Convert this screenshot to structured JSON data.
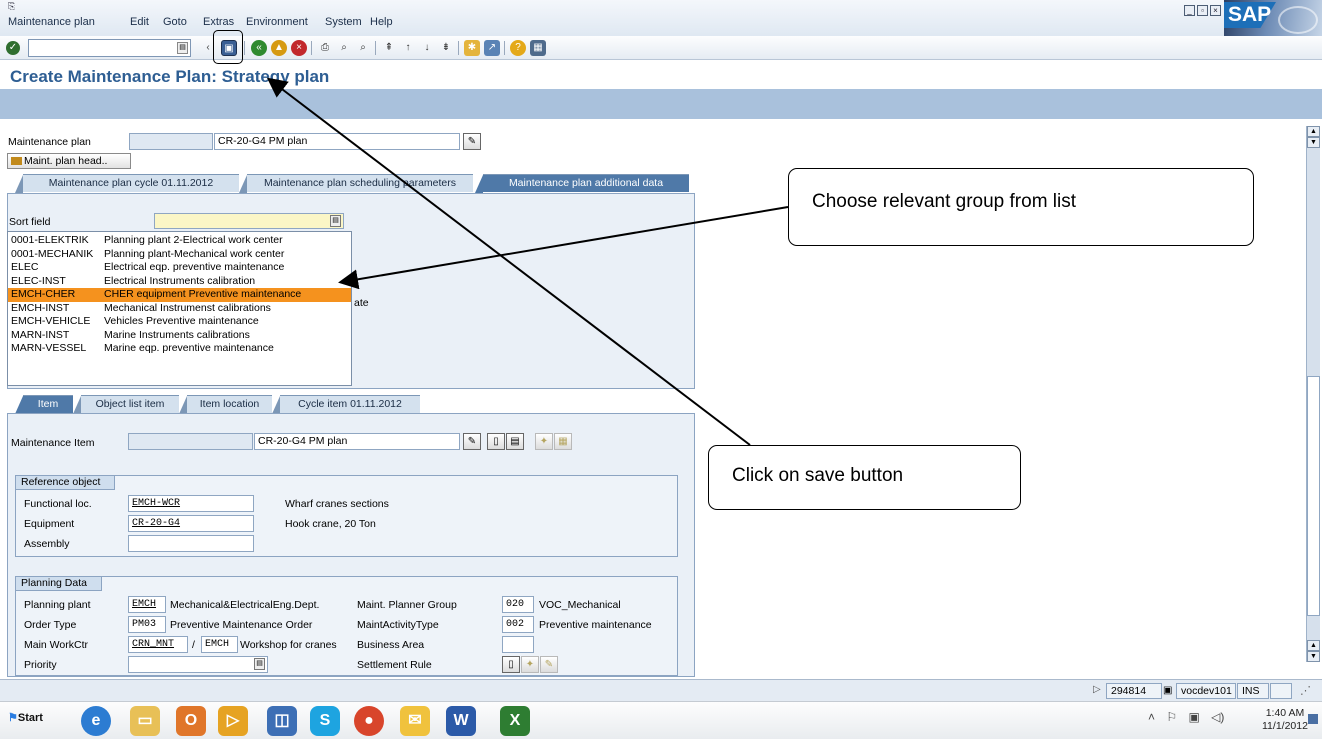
{
  "menubar": {
    "items": [
      "Maintenance plan",
      "Edit",
      "Goto",
      "Extras",
      "Environment",
      "System",
      "Help"
    ],
    "sap_logo": "SAP"
  },
  "toolbar": {
    "icons": [
      "enter-icon",
      "command-field-dropdown-icon",
      "back-arrow-icon",
      "save-icon",
      "back-icon",
      "exit-icon",
      "cancel-icon",
      "print-icon",
      "find-icon",
      "find-next-icon",
      "first-page-icon",
      "previous-page-icon",
      "next-page-icon",
      "last-page-icon",
      "create-session-icon",
      "shortcut-icon",
      "help-icon",
      "customize-layout-icon"
    ]
  },
  "title": "Create Maintenance Plan: Strategy plan",
  "header": {
    "plan_label": "Maintenance plan",
    "plan_text": "CR-20-G4 PM plan",
    "head_button": "Maint. plan head.."
  },
  "top_tabs": [
    "Maintenance plan cycle 01.11.2012",
    "Maintenance plan scheduling parameters",
    "Maintenance plan additional data"
  ],
  "sort_field_label": "Sort field",
  "dropdown": {
    "rows": [
      {
        "key": "0001-ELEKTRIK",
        "desc": "Planning plant 2-Electrical work center"
      },
      {
        "key": "0001-MECHANIK",
        "desc": "Planning plant-Mechanical work center"
      },
      {
        "key": "ELEC",
        "desc": "Electrical  eqp. preventive maintenance"
      },
      {
        "key": "ELEC-INST",
        "desc": "Electrical Instruments calibration"
      },
      {
        "key": "EMCH-CHER",
        "desc": "CHER equipment Preventive maintenance"
      },
      {
        "key": "EMCH-INST",
        "desc": "Mechanical Instrumenst calibrations"
      },
      {
        "key": "EMCH-VEHICLE",
        "desc": "Vehicles Preventive maintenance"
      },
      {
        "key": "MARN-INST",
        "desc": "Marine Instruments calibrations"
      },
      {
        "key": "MARN-VESSEL",
        "desc": "Marine eqp. preventive maintenance"
      }
    ],
    "selected_index": 4,
    "partially_hidden_text": "ate"
  },
  "item_tabs": [
    "Item",
    "Object list item",
    "Item location",
    "Cycle item 01.11.2012"
  ],
  "item": {
    "label": "Maintenance Item",
    "text": "CR-20-G4 PM plan"
  },
  "reference_object": {
    "title": "Reference object",
    "functional_loc_label": "Functional loc.",
    "functional_loc": "EMCH-WCR",
    "functional_loc_desc": "Wharf cranes sections",
    "equipment_label": "Equipment",
    "equipment": "CR-20-G4",
    "equipment_desc": "Hook crane, 20 Ton",
    "assembly_label": "Assembly",
    "assembly": ""
  },
  "planning_data": {
    "title": "Planning Data",
    "planning_plant_label": "Planning plant",
    "planning_plant": "EMCH",
    "planning_plant_desc": "Mechanical&ElectricalEng.Dept.",
    "planner_group_label": "Maint. Planner Group",
    "planner_group": "020",
    "planner_group_desc": "VOC_Mechanical",
    "order_type_label": "Order Type",
    "order_type": "PM03",
    "order_type_desc": "Preventive Maintenance Order",
    "activity_type_label": "MaintActivityType",
    "activity_type": "002",
    "activity_type_desc": "Preventive maintenance",
    "work_ctr_label": "Main WorkCtr",
    "work_ctr": "CRN_MNT",
    "work_ctr_sep": "/",
    "work_ctr_plant": "EMCH",
    "work_ctr_desc": "Workshop for cranes",
    "business_area_label": "Business Area",
    "business_area": "",
    "priority_label": "Priority",
    "priority": "",
    "settlement_rule_label": "Settlement Rule"
  },
  "statusbar": {
    "session": "294814",
    "server": "vocdev101",
    "mode": "INS"
  },
  "taskbar": {
    "start": "Start",
    "time": "1:40 AM",
    "date": "11/1/2012",
    "apps": [
      "internet-explorer-icon",
      "file-explorer-icon",
      "outlook-icon",
      "sap-logon-icon",
      "remote-desktop-icon",
      "skype-icon",
      "chrome-icon",
      "lotus-notes-icon",
      "word-icon",
      "excel-icon"
    ]
  },
  "callouts": {
    "group": "Choose relevant group from list",
    "save": "Click on save button"
  },
  "colors": {
    "title": "#2e5e93",
    "tab_active": "#4f79a8",
    "selected_row": "#f5921e",
    "sort_field": "#fbf6c6"
  }
}
